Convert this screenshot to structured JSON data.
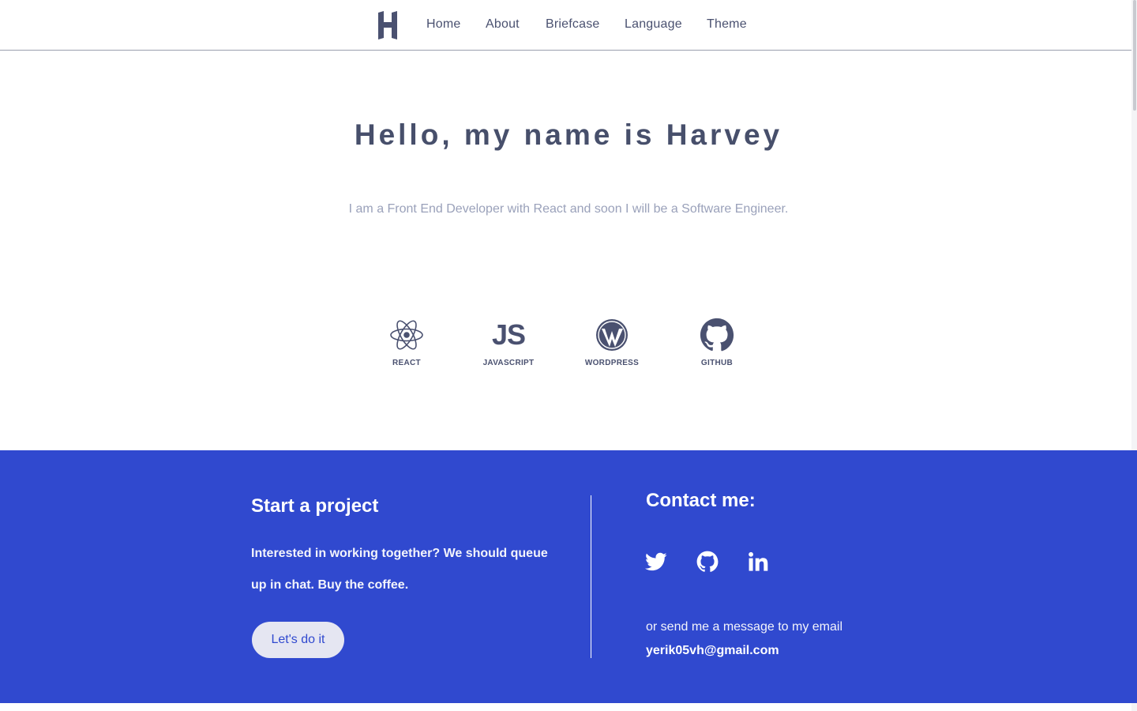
{
  "nav": {
    "logo_icon": "h-logo-icon",
    "links": [
      "Home",
      "About",
      "Briefcase",
      "Language",
      "Theme"
    ]
  },
  "hero": {
    "title": "Hello, my name is Harvey",
    "subtitle": "I am a Front End Developer with React and soon I will be a Software Engineer."
  },
  "skills": [
    {
      "label": "REACT",
      "icon": "react-icon"
    },
    {
      "label": "JAVASCRIPT",
      "icon": "js-icon",
      "glyph": "JS"
    },
    {
      "label": "WORDPRESS",
      "icon": "wordpress-icon"
    },
    {
      "label": "GITHUB",
      "icon": "github-icon"
    }
  ],
  "footer": {
    "start_title": "Start a project",
    "start_text": "Interested in working together? We should queue up in chat. Buy the coffee.",
    "cta_label": "Let's do it",
    "contact_title": "Contact me:",
    "social_icons": [
      "twitter-icon",
      "github-icon",
      "linkedin-icon"
    ],
    "email_note": "or send me a message to my email",
    "email": "yerik05vh@gmail.com"
  },
  "colors": {
    "accent": "#3049cf",
    "text": "#474f6b",
    "muted": "#9aa1ba",
    "button_bg": "#e5e6f2"
  }
}
